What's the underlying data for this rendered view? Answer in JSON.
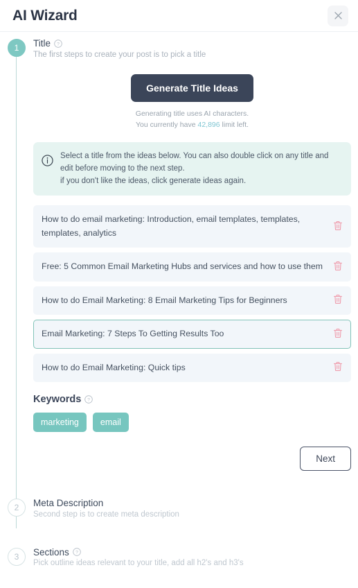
{
  "header": {
    "title": "AI Wizard",
    "close_label": "Close",
    "close_icon": "close-icon"
  },
  "steps": [
    {
      "number": "1",
      "title": "Title",
      "subtitle": "The first steps to create your post is to pick a title",
      "help_icon": "help-circle-icon",
      "state": "active"
    },
    {
      "number": "2",
      "title": "Meta Description",
      "subtitle": "Second step is to create meta description",
      "state": "inactive"
    },
    {
      "number": "3",
      "title": "Sections",
      "subtitle": "Pick outline ideas relevant to your title, add all h2's and h3's",
      "help_icon": "help-circle-icon",
      "state": "inactive"
    }
  ],
  "panel": {
    "generate_button_label": "Generate Title Ideas",
    "generate_note_line1": "Generating title uses AI characters.",
    "generate_note_line2_prefix": "You currently have ",
    "generate_note_limit": "42,896",
    "generate_note_line2_suffix": " limit left.",
    "info": {
      "icon": "info-circle-icon",
      "line1": "Select a title from the ideas below. You can also double click on any title and edit before moving to the next step.",
      "line2": "if you don't like the ideas, click generate ideas again."
    },
    "ideas": [
      {
        "text": "How to do email marketing: Introduction, email templates, templates, templates, analytics",
        "selected": false,
        "delete_icon": "trash-icon"
      },
      {
        "text": "Free: 5 Common Email Marketing Hubs and services and how to use them",
        "selected": false,
        "delete_icon": "trash-icon"
      },
      {
        "text": "How to do Email Marketing: 8 Email Marketing Tips for Beginners",
        "selected": false,
        "delete_icon": "trash-icon"
      },
      {
        "text": "Email Marketing: 7 Steps To Getting Results Too",
        "selected": true,
        "delete_icon": "trash-icon"
      },
      {
        "text": "How to do Email Marketing: Quick tips",
        "selected": false,
        "delete_icon": "trash-icon"
      }
    ],
    "keywords": {
      "label": "Keywords",
      "help_icon": "help-circle-icon",
      "chips": [
        "marketing",
        "email"
      ]
    },
    "next_button_label": "Next"
  },
  "colors": {
    "accent_teal": "#7ec8c2",
    "dark_button": "#3b4559",
    "info_bg": "#e6f4f1",
    "idea_bg": "#f2f6fa",
    "selected_border": "#82c3b8",
    "trash_pink": "#ef9bab",
    "limit_text": "#7fc5d2"
  }
}
